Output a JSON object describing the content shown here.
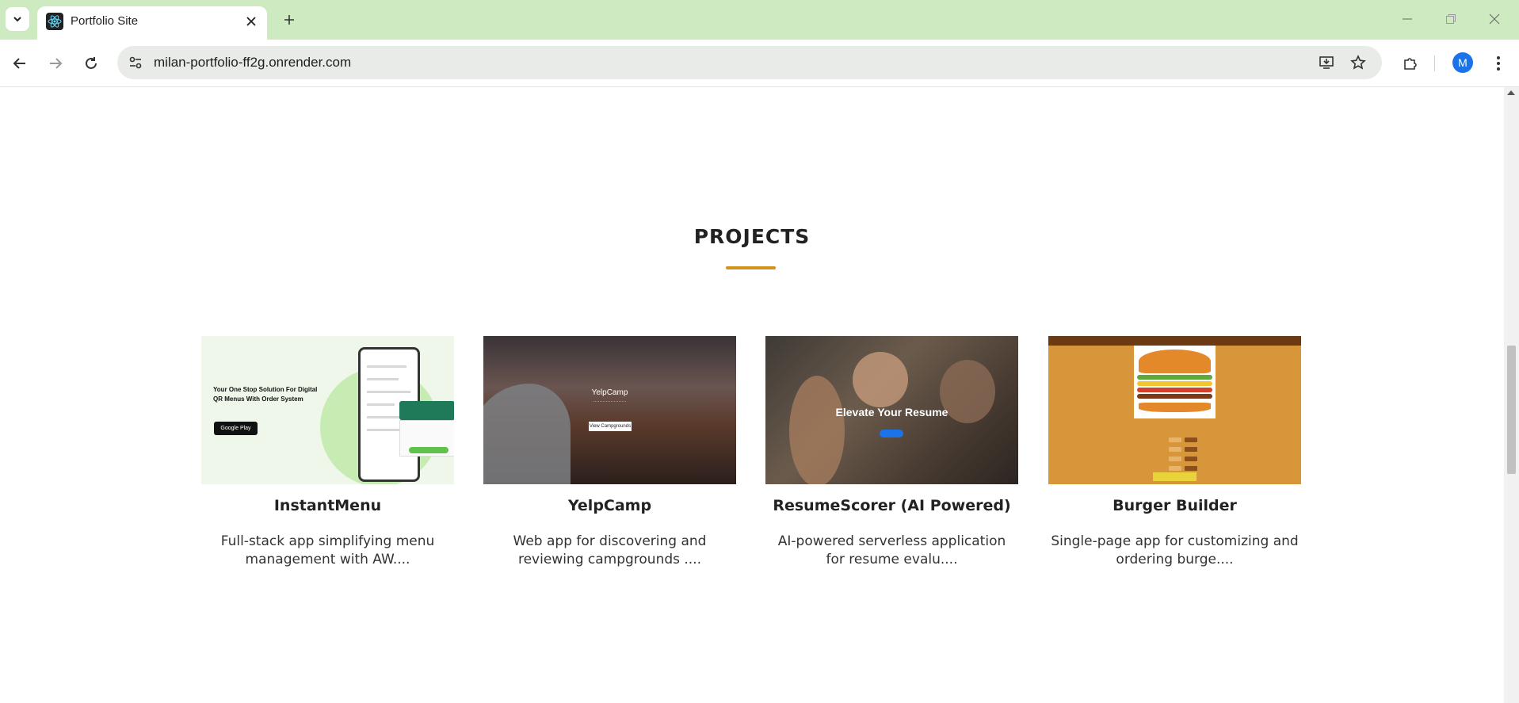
{
  "browser": {
    "tab_title": "Portfolio Site",
    "url": "milan-portfolio-ff2g.onrender.com",
    "profile_initial": "M"
  },
  "page": {
    "section_title": "PROJECTS",
    "accent_color": "#d4921f",
    "projects": [
      {
        "name": "InstantMenu",
        "description": "Full-stack app simplifying menu management with AW....",
        "thumb": {
          "headline": "Your One Stop Solution For Digital QR Menus With Order System",
          "button": "Google Play"
        }
      },
      {
        "name": "YelpCamp",
        "description": "Web app for discovering and reviewing campgrounds ....",
        "thumb": {
          "headline": "YelpCamp",
          "button": "View Campgrounds"
        }
      },
      {
        "name": "ResumeScorer (AI Powered)",
        "description": "AI-powered serverless application for resume evalu....",
        "thumb": {
          "headline": "Elevate Your Resume"
        }
      },
      {
        "name": "Burger Builder",
        "description": "Single-page app for customizing and ordering burge...."
      }
    ]
  }
}
